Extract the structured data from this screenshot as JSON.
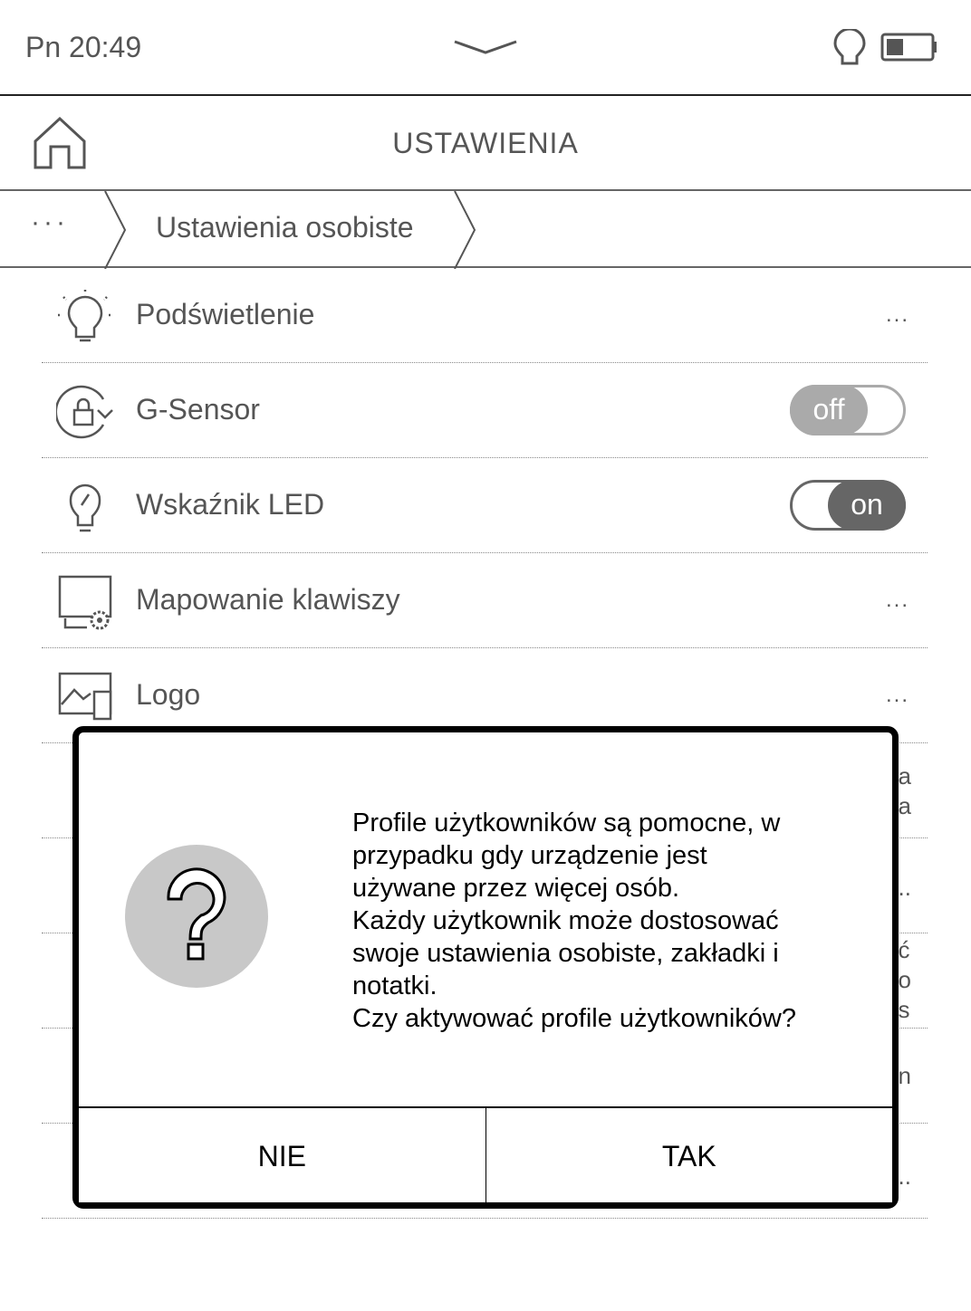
{
  "status_bar": {
    "time": "Pn 20:49",
    "icons": [
      "chevron-down-icon",
      "frontlight-icon",
      "battery-icon"
    ],
    "battery_level": 0.3
  },
  "header": {
    "title": "USTAWIENIA",
    "home_icon": "home-icon"
  },
  "breadcrumb": {
    "more": "···",
    "current": "Ustawienia osobiste"
  },
  "rows": [
    {
      "label": "Podświetlenie",
      "icon": "bulb-icon",
      "more": "..."
    },
    {
      "label": "G-Sensor",
      "icon": "rotation-lock-icon",
      "toggle": "off"
    },
    {
      "label": "Wskaźnik LED",
      "icon": "led-icon",
      "toggle": "on"
    },
    {
      "label": "Mapowanie klawiszy",
      "icon": "key-mapping-icon",
      "more": "..."
    },
    {
      "label": "Logo",
      "icon": "logo-image-icon",
      "more": "..."
    }
  ],
  "hidden_rows": [
    {
      "frag": "a\na"
    },
    {
      "frag": "..."
    },
    {
      "frag": "ć\no\ns"
    },
    {
      "frag": "n"
    },
    {
      "frag": "..."
    }
  ],
  "dialog": {
    "icon": "question-icon",
    "lines": [
      "Profile użytkowników są pomocne, w",
      "przypadku gdy urządzenie jest",
      "używane przez więcej osób.",
      "Każdy użytkownik może dostosować",
      "swoje ustawienia osobiste, zakładki i",
      "notatki.",
      "Czy aktywować profile użytkowników?"
    ],
    "no": "NIE",
    "yes": "TAK"
  }
}
